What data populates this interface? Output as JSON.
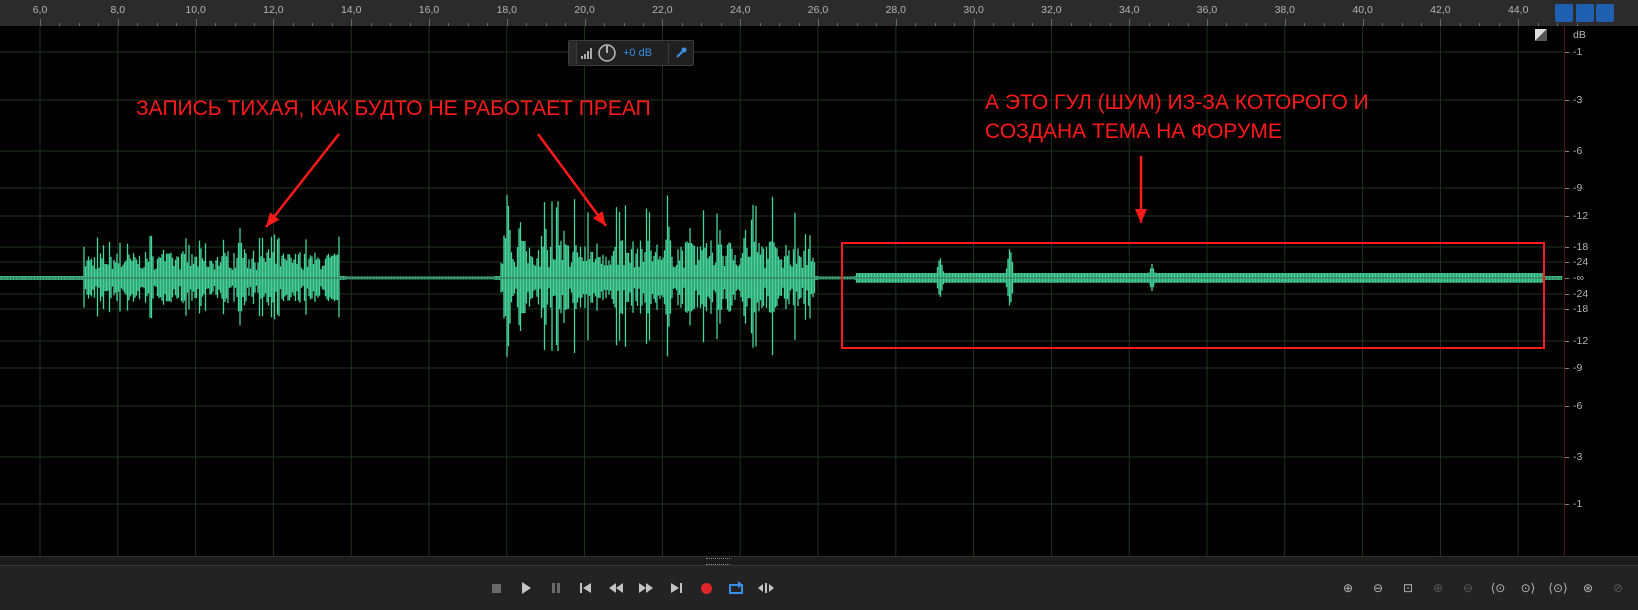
{
  "ruler": {
    "ticks": [
      "6,0",
      "8,0",
      "10,0",
      "12,0",
      "14,0",
      "16,0",
      "18,0",
      "20,0",
      "22,0",
      "24,0",
      "26,0",
      "28,0",
      "30,0",
      "32,0",
      "34,0",
      "36,0",
      "38,0",
      "40,0",
      "42,0",
      "44,0"
    ]
  },
  "db_scale": {
    "unit": "dB",
    "labels": [
      "-1",
      "-3",
      "-6",
      "-9",
      "-12",
      "-18",
      "-24",
      "-∞",
      "-24",
      "-18",
      "-12",
      "-9",
      "-6",
      "-3",
      "-1"
    ]
  },
  "hud": {
    "gain": "+0 dB"
  },
  "annotations": {
    "left_text": "ЗАПИСЬ ТИХАЯ, КАК БУДТО НЕ РАБОТАЕТ ПРЕАП",
    "right_text_line1": "А ЭТО ГУЛ (ШУМ) ИЗ-ЗА КОТОРОГО И",
    "right_text_line2": "СОЗДАНА ТЕМА НА ФОРУМЕ"
  },
  "transport": {
    "stop_icon": "stop-icon",
    "play_icon": "play-icon",
    "pause_icon": "pause-icon",
    "record_icon": "record-icon",
    "record_color": "#e0262b"
  },
  "colors": {
    "waveform": "#44d49a",
    "annotation": "#ff1a1a",
    "accent": "#3a8ee6"
  }
}
